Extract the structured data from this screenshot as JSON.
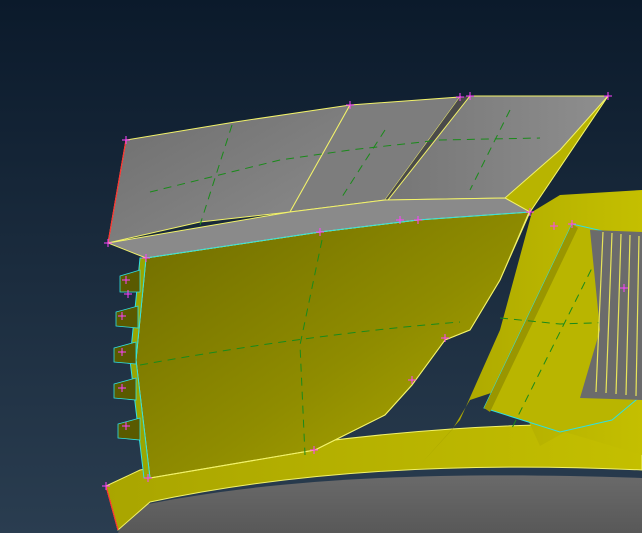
{
  "viewport": {
    "background_top": "#0b1a2b",
    "background_bottom": "#2a3d50",
    "colors": {
      "shell_yellow": "#b8b400",
      "shell_dark_yellow": "#7c7a00",
      "shell_grey": "#7f7f7f",
      "shell_light_grey": "#9a9a9a",
      "edge_yellow": "#f2f26a",
      "edge_red": "#ff3030",
      "edge_cyan": "#30e0e0",
      "edge_green_dashed": "#1a8a1a",
      "node_marker": "#ff40ff"
    }
  }
}
